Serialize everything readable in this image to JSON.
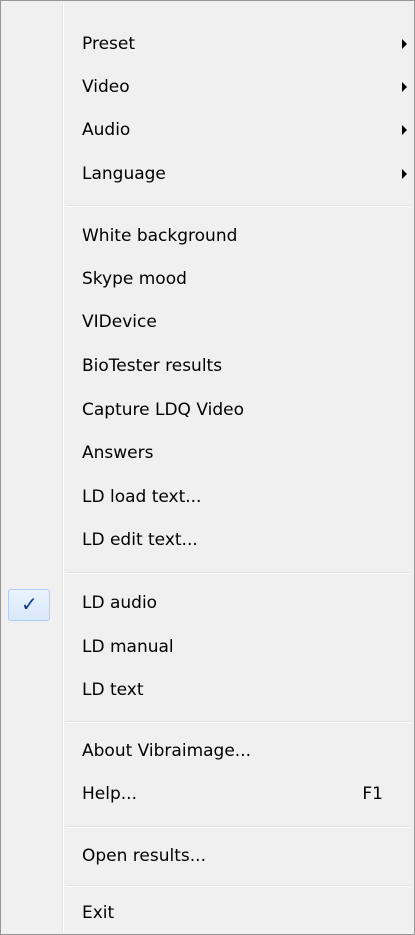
{
  "menu": {
    "group1": [
      {
        "label": "Preset"
      },
      {
        "label": "Video"
      },
      {
        "label": "Audio"
      },
      {
        "label": "Language"
      }
    ],
    "group2": [
      {
        "label": "White background"
      },
      {
        "label": "Skype mood"
      },
      {
        "label": "VIDevice"
      },
      {
        "label": "BioTester results"
      },
      {
        "label": "Capture LDQ Video"
      },
      {
        "label": "Answers"
      },
      {
        "label": "LD load text..."
      },
      {
        "label": "LD edit text..."
      }
    ],
    "group3": [
      {
        "label": "LD audio",
        "checked": true,
        "check_glyph": "✓"
      },
      {
        "label": "LD manual"
      },
      {
        "label": "LD text"
      }
    ],
    "group4": [
      {
        "label": "About Vibraimage..."
      },
      {
        "label": "Help...",
        "shortcut": "F1"
      }
    ],
    "group5": [
      {
        "label": "Open results..."
      }
    ],
    "group6": [
      {
        "label": "Exit"
      }
    ]
  }
}
